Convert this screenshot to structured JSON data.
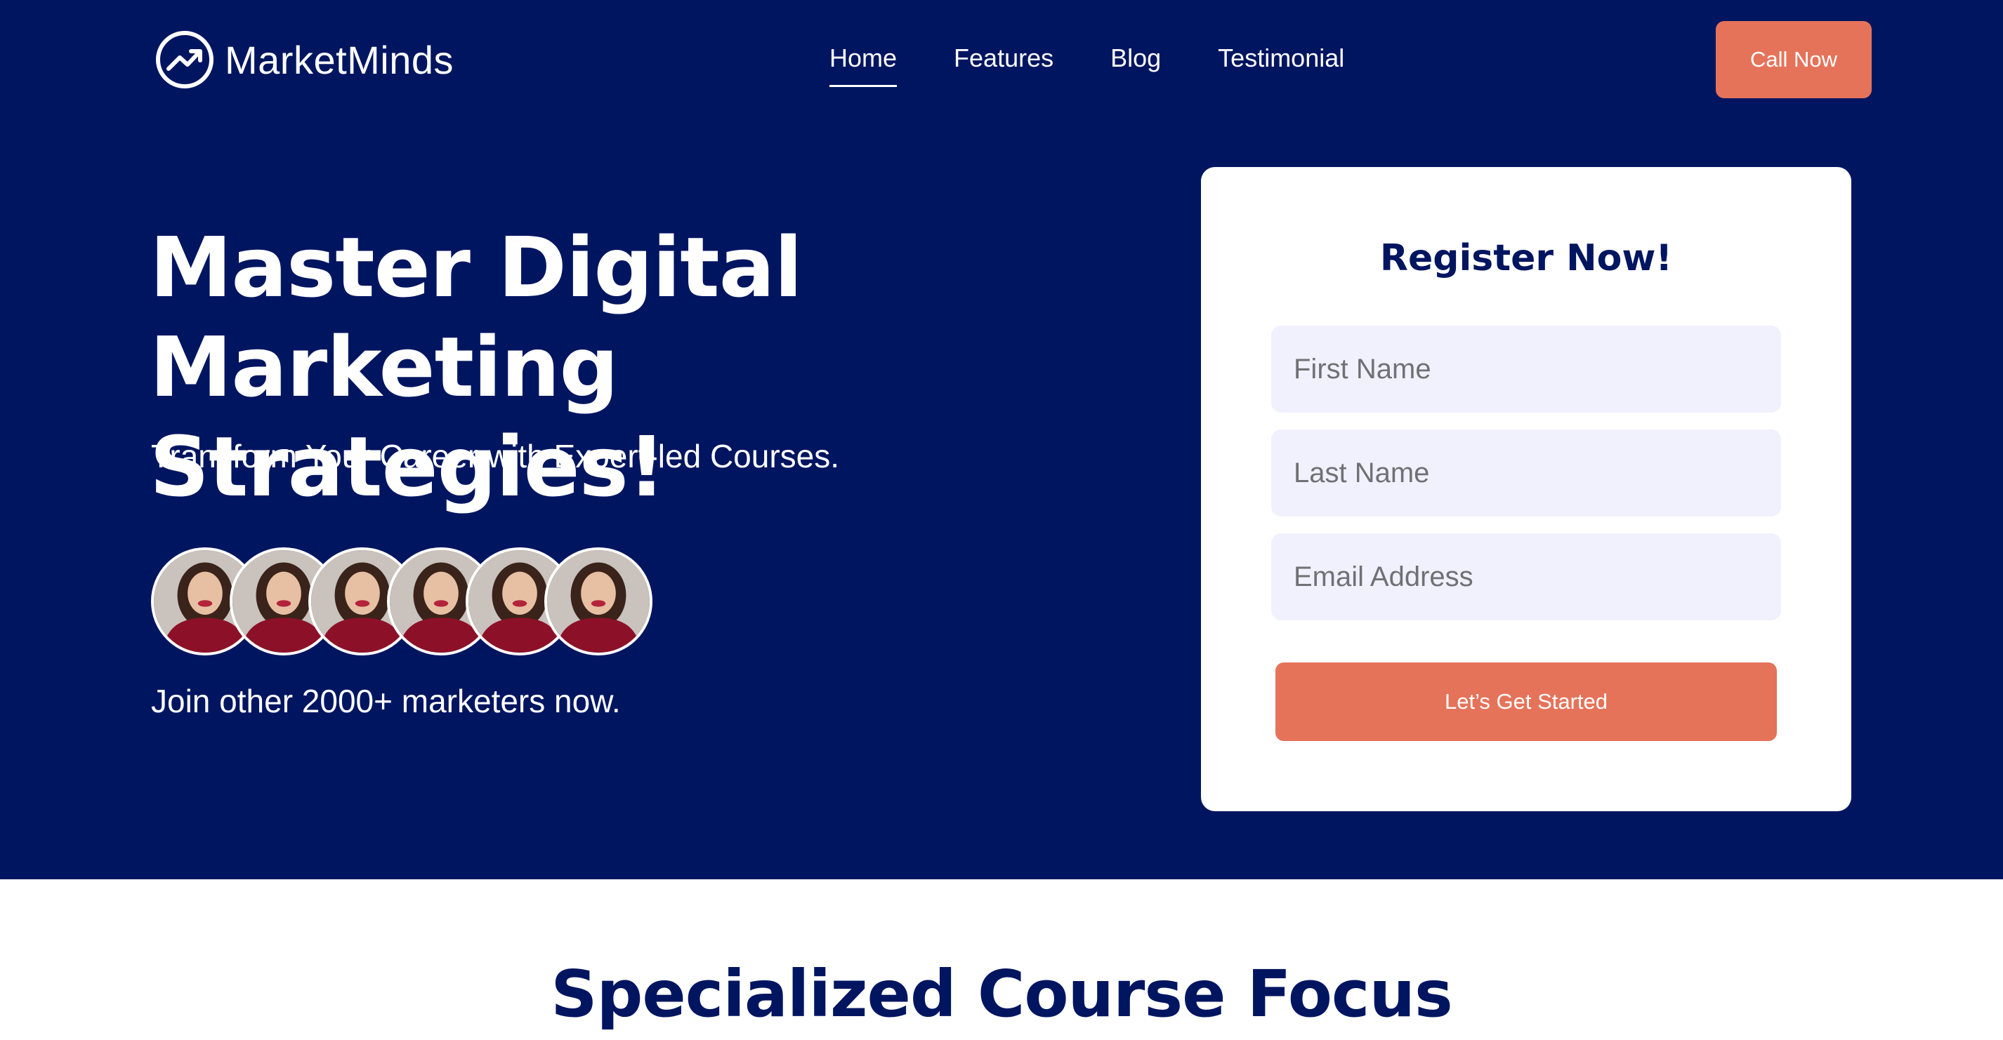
{
  "brand": {
    "name": "MarketMinds",
    "logo_icon": "trending-up-circle-icon"
  },
  "nav": {
    "items": [
      {
        "label": "Home",
        "active": true
      },
      {
        "label": "Features",
        "active": false
      },
      {
        "label": "Blog",
        "active": false
      },
      {
        "label": "Testimonial",
        "active": false
      }
    ],
    "call_label": "Call Now"
  },
  "hero": {
    "headline": "Master Digital Marketing Strategies!",
    "subheadline": "Transform Your Career with Expert-led Courses.",
    "avatar_count": 6,
    "join_text": "Join other 2000+ marketers now."
  },
  "register": {
    "title": "Register Now!",
    "first_name_placeholder": "First Name",
    "last_name_placeholder": "Last Name",
    "email_placeholder": "Email Address",
    "submit_label": "Let’s Get Started"
  },
  "section": {
    "title": "Specialized Course Focus"
  },
  "colors": {
    "hero_bg": "#001560",
    "accent": "#e5735a",
    "field_bg": "#f1f1fd",
    "heading_dark": "#001560"
  }
}
